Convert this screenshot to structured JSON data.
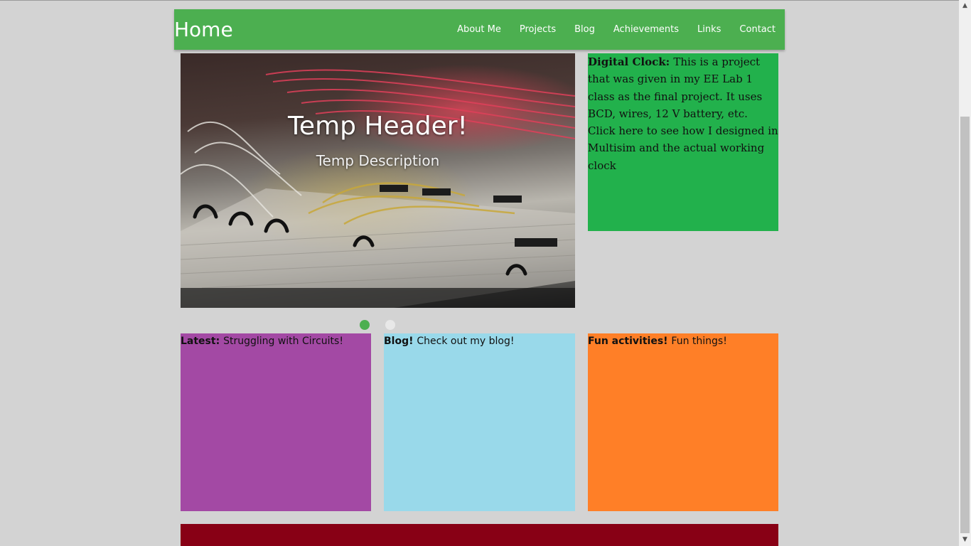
{
  "navbar": {
    "brand": "Home",
    "links": [
      "About Me",
      "Projects",
      "Blog",
      "Achievements",
      "Links",
      "Contact"
    ],
    "color": "#4caf50"
  },
  "hero": {
    "title": "Temp Header!",
    "description": "Temp Description"
  },
  "carousel": {
    "slides": 2,
    "active_index": 0
  },
  "project": {
    "label": "Digital Clock:",
    "text": "This is a project that was given in my EE Lab 1 class as the final project. It uses BCD, wires, 12 V battery, etc. Click here to see how I designed in Multisim and the actual working clock",
    "color": "#22b14c"
  },
  "boxes": [
    {
      "label": "Latest:",
      "text": "Struggling with Circuits!",
      "color": "#a349a4"
    },
    {
      "label": "Blog!",
      "text": "Check out my blog!",
      "color": "#99d9ea"
    },
    {
      "label": "Fun activities!",
      "text": "Fun things!",
      "color": "#ff7f27"
    }
  ],
  "footer": {
    "color": "#880015"
  },
  "icons": {
    "scroll_up": "scroll-up-arrow-icon",
    "scroll_down": "scroll-down-arrow-icon"
  }
}
